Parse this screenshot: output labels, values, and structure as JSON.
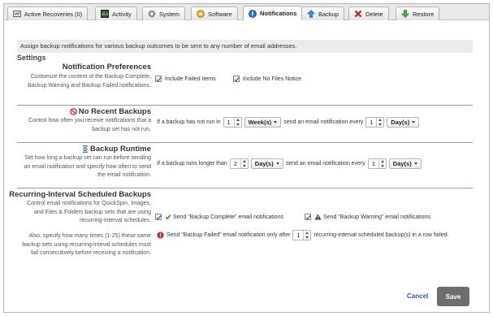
{
  "tabs": [
    {
      "label": "Active Recoveries (0)",
      "icon": "active-recoveries-icon"
    },
    {
      "label": "Activity",
      "icon": "activity-icon"
    },
    {
      "label": "System",
      "icon": "system-gear-icon"
    },
    {
      "label": "Software",
      "icon": "software-icon"
    },
    {
      "label": "Notifications",
      "icon": "notifications-icon",
      "active": true
    },
    {
      "label": "Backup",
      "icon": "backup-up-arrow-icon"
    },
    {
      "label": "Delete",
      "icon": "delete-x-icon"
    },
    {
      "label": "Restore",
      "icon": "restore-down-arrow-icon"
    }
  ],
  "banner": "Assign backup notifications for various backup outcomes to be sent to any number of email addresses.",
  "settings_heading": "Settings",
  "preferences": {
    "title": "Notification Preferences",
    "desc": "Customize the content of the Backup Complete, Backup Warning and Backup Failed notifications.",
    "include_failed": "Include Failed Items",
    "include_no_files": "Include No Files Notice"
  },
  "no_recent": {
    "title": "No Recent Backups",
    "desc": "Control how often you receive notifications that a backup set has not run.",
    "prefix": "If a backup has not run in",
    "value1": "1",
    "unit1": "Week(s)",
    "middle": "send an email notification every",
    "value2": "1",
    "unit2": "Day(s)"
  },
  "runtime": {
    "title": "Backup Runtime",
    "desc": "Set how long a backup set can run before sending an email notification and specify how often to send the email notification.",
    "prefix": "If a backup runs longer than",
    "value1": "2",
    "unit1": "Day(s)",
    "middle": "send an email notification every",
    "value2": "1",
    "unit2": "Day(s)"
  },
  "recurring": {
    "title": "Recurring-Interval Scheduled Backups",
    "desc": "Control email notifications for QuickSpin, Images, and Files & Folders backup sets that are using recurring-interval schedules.",
    "complete_label": "Send \"Backup Complete\" email notifications",
    "warning_label": "Send \"Backup Warning\" email notifications",
    "desc2": "Also, specify how many times (1-25) these same backup sets using recurring-inteval schedules must fail consecutively before receiving a notification.",
    "failed_prefix": "Send \"Backup Failed\" email notification only after",
    "failed_value": "1",
    "failed_suffix": "recurring-interval scheduled backup(s) in a row failed."
  },
  "buttons": {
    "cancel": "Cancel",
    "save": "Save"
  },
  "colors": {
    "link": "#2b5aa6",
    "save_bg": "#6e6e6e",
    "error_red": "#c8202a"
  }
}
